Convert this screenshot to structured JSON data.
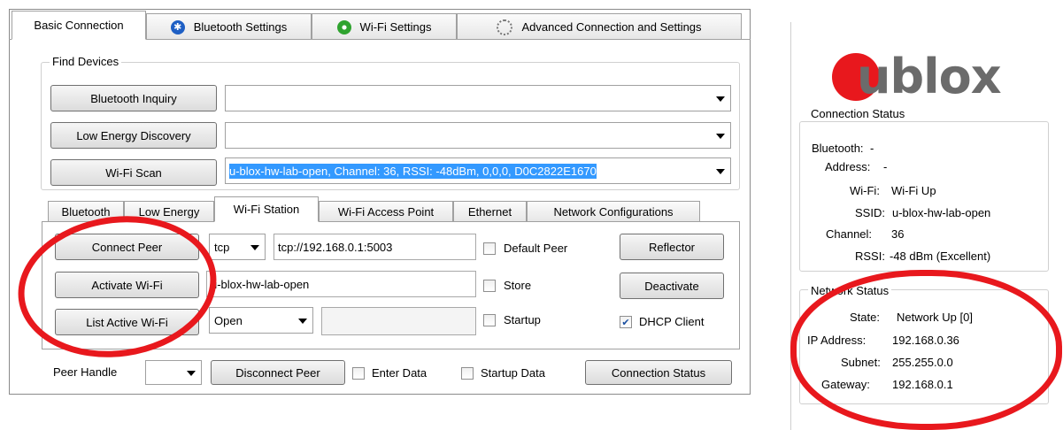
{
  "main_tabs": [
    {
      "label": "Basic Connection",
      "active": true,
      "icon": ""
    },
    {
      "label": "Bluetooth Settings",
      "icon": "bluetooth-icon"
    },
    {
      "label": "Wi-Fi Settings",
      "icon": "wifi-icon"
    },
    {
      "label": "Advanced Connection and Settings",
      "icon": "gear-icon"
    }
  ],
  "find_devices": {
    "title": "Find Devices",
    "bt_inquiry": {
      "label": "Bluetooth Inquiry",
      "value": ""
    },
    "le_discovery": {
      "label": "Low Energy Discovery",
      "value": ""
    },
    "wifi_scan": {
      "label": "Wi-Fi Scan",
      "value": "u-blox-hw-lab-open, Channel: 36, RSSI: -48dBm, 0,0,0, D0C2822E1670"
    }
  },
  "sub_tabs": [
    {
      "label": "Bluetooth"
    },
    {
      "label": "Low Energy"
    },
    {
      "label": "Wi-Fi Station",
      "active": true
    },
    {
      "label": "Wi-Fi Access Point"
    },
    {
      "label": "Ethernet"
    },
    {
      "label": "Network Configurations"
    }
  ],
  "station": {
    "connect_peer": "Connect Peer",
    "protocol": "tcp",
    "peer_url": "tcp://192.168.0.1:5003",
    "default_peer": "Default Peer",
    "reflector": "Reflector",
    "activate_wifi": "Activate Wi-Fi",
    "ssid_value": "u-blox-hw-lab-open",
    "store": "Store",
    "deactivate": "Deactivate",
    "list_active_wifi": "List Active Wi-Fi",
    "security": "Open",
    "password_value": "",
    "startup": "Startup",
    "dhcp_client": "DHCP Client",
    "dhcp_checked": true
  },
  "bottom": {
    "peer_handle": "Peer Handle",
    "disconnect_peer": "Disconnect Peer",
    "enter_data": "Enter Data",
    "startup_data": "Startup Data",
    "connection_status": "Connection Status"
  },
  "logo_text": "ublox",
  "colors": {
    "brand": "#e8181d",
    "highlight": "#3399ff",
    "ring": "#e8181d"
  },
  "connection_status": {
    "title": "Connection Status",
    "bluetooth_label": "Bluetooth:",
    "bluetooth_value": "-",
    "address_label": "Address:",
    "address_value": "-",
    "wifi_label": "Wi-Fi:",
    "wifi_value": "Wi-Fi Up",
    "ssid_label": "SSID:",
    "ssid_value": "u-blox-hw-lab-open",
    "channel_label": "Channel:",
    "channel_value": "36",
    "rssi_label": "RSSI:",
    "rssi_value": "-48 dBm (Excellent)"
  },
  "network_status": {
    "title": "Network Status",
    "state_label": "State:",
    "state_value": "Network Up [0]",
    "ip_label": "IP Address:",
    "ip_value": "192.168.0.36",
    "subnet_label": "Subnet:",
    "subnet_value": "255.255.0.0",
    "gateway_label": "Gateway:",
    "gateway_value": "192.168.0.1"
  }
}
